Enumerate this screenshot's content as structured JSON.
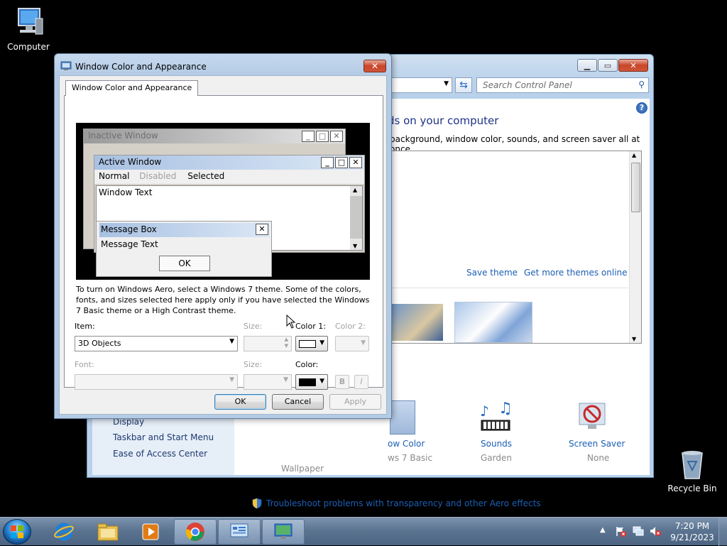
{
  "desktop": {
    "computer_label": "Computer",
    "recycle_bin_label": "Recycle Bin"
  },
  "control_panel": {
    "search_placeholder": "Search Control Panel",
    "heading": "ds on your computer",
    "subtitle": "background, window color, sounds, and screen saver all at once.",
    "save_theme": "Save theme",
    "get_more_themes": "Get more themes online",
    "bottom_items": [
      {
        "label": "ow Color",
        "sub": "ws 7 Basic"
      },
      {
        "label": "Sounds",
        "sub": "Garden"
      },
      {
        "label": "Screen Saver",
        "sub": "None"
      }
    ],
    "wallpaper_label": "Wallpaper",
    "left_links": [
      "Display",
      "Taskbar and Start Menu",
      "Ease of Access Center"
    ],
    "troubleshoot_link": "Troubleshoot problems with transparency and other Aero effects"
  },
  "dialog": {
    "title": "Window Color and Appearance",
    "tab_label": "Window Color and Appearance",
    "preview": {
      "inactive_window": "Inactive Window",
      "active_window": "Active Window",
      "menu_normal": "Normal",
      "menu_disabled": "Disabled",
      "menu_selected": "Selected",
      "window_text": "Window Text",
      "message_box": "Message Box",
      "message_text": "Message Text",
      "ok": "OK"
    },
    "description": "To turn on Windows Aero, select a Windows 7 theme.  Some of the colors, fonts, and sizes selected here apply only if you have selected the Windows 7 Basic theme or a High Contrast theme.",
    "item_label": "Item:",
    "item_value": "3D Objects",
    "size_label": "Size:",
    "color1_label": "Color 1:",
    "color2_label": "Color 2:",
    "font_label": "Font:",
    "font_size_label": "Size:",
    "font_color_label": "Color:",
    "bold_label": "B",
    "italic_label": "I",
    "color1_swatch": "#ffffff",
    "font_color_swatch": "#000000",
    "ok_button": "OK",
    "cancel_button": "Cancel",
    "apply_button": "Apply"
  },
  "taskbar": {
    "time": "7:20 PM",
    "date": "9/21/2023"
  },
  "colors": {
    "accent_link": "#1c5fb5",
    "titlebar_active_preview": "#c9d9ee",
    "titlebar_inactive_preview": "#d8d8d8"
  }
}
